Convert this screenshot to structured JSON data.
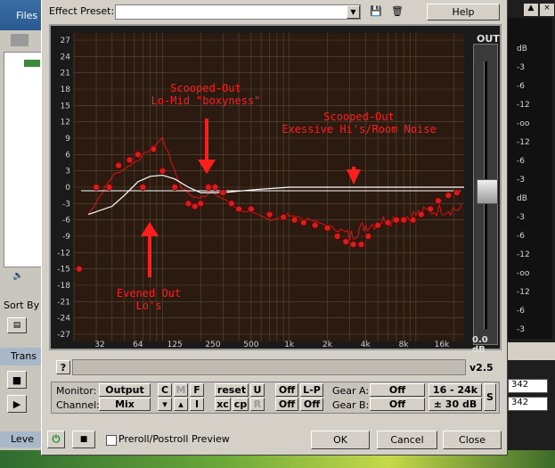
{
  "host": {
    "files_tab": "Files",
    "sort_by": "Sort By",
    "transport_tab": "Trans",
    "levels_tab": "Leve",
    "box_1": "342",
    "box_2": "342",
    "right_meter_labels": [
      "dB",
      "-3",
      "-6",
      "-12",
      "-oo",
      "-12",
      "-6",
      "-3",
      "dB",
      "-3",
      "-6",
      "-12",
      "-oo",
      "-12",
      "-6",
      "-3"
    ]
  },
  "toolbar": {
    "preset_label": "Effect Preset:",
    "preset_value": "",
    "help_label": "Help"
  },
  "plugin": {
    "out_label": "OUT",
    "out_value": "0.0 dB",
    "help_btn": "?",
    "version": "v2.5",
    "y_labels": [
      "27",
      "24",
      "21",
      "18",
      "15",
      "12",
      "9",
      "6",
      "3",
      "0",
      "-3",
      "-6",
      "-9",
      "-12",
      "-15",
      "-18",
      "-21",
      "-24",
      "-27"
    ],
    "x_labels": [
      "32",
      "64",
      "125",
      "250",
      "500",
      "1k",
      "2k",
      "4k",
      "8k",
      "16k"
    ],
    "annotations": {
      "scooped_lomid_1": "Scooped-Out",
      "scooped_lomid_2": "Lo-Mid \"boxyness\"",
      "scooped_hi_1": "Scooped-Out",
      "scooped_hi_2": "Exessive Hi's/Room Noise",
      "evened_1": "Evened Out",
      "evened_2": "Lo's"
    },
    "colors": {
      "grid_bg": "#2b1a10",
      "grid_line": "#5a4a3a",
      "annotation": "#ff1e1e",
      "curve": "#ffffff",
      "analyzer": "#e01010"
    }
  },
  "controls": {
    "monitor_label": "Monitor:",
    "monitor_value": "Output",
    "channel_label": "Channel:",
    "channel_value": "Mix",
    "c": "C",
    "m": "M",
    "f": "F",
    "down": "▾",
    "up": "▴",
    "i": "I",
    "reset": "reset",
    "u": "U",
    "xc": "xc",
    "cp": "cp",
    "r": "R",
    "off1": "Off",
    "lp": "L-P",
    "off2": "Off",
    "off3": "Off",
    "gear_a_label": "Gear A:",
    "gear_a_value": "Off",
    "gear_b_label": "Gear B:",
    "gear_b_value": "Off",
    "range_freq": "16 - 24k",
    "range_db": "± 30 dB",
    "s": "S"
  },
  "footer": {
    "preroll_label": "Preroll/Postroll Preview",
    "ok": "OK",
    "cancel": "Cancel",
    "close": "Close"
  }
}
